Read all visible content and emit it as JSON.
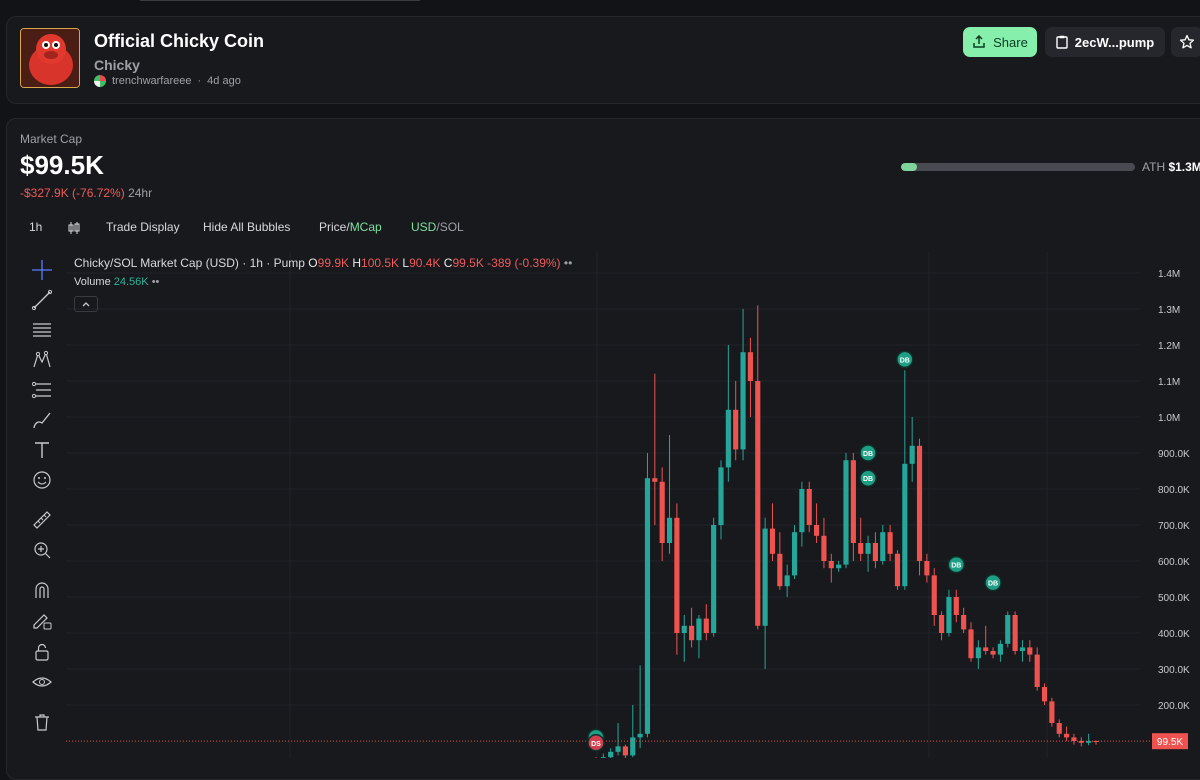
{
  "token": {
    "name": "Official Chicky Coin",
    "ticker": "Chicky",
    "creator": "trenchwarfareee",
    "age": "4d ago"
  },
  "actions": {
    "share_label": "Share",
    "contract_label": "2ecW...pump"
  },
  "market_cap": {
    "label": "Market Cap",
    "value": "$99.5K",
    "change": "-$327.9K (-76.72%)",
    "period": "24hr",
    "ath_label": "ATH",
    "ath_value": "$1.3M",
    "ath_progress": 0.07
  },
  "toolbar": {
    "interval": "1h",
    "trade_display": "Trade Display",
    "hide_bubbles": "Hide All Bubbles",
    "price_label": "Price",
    "mcap_label": "MCap",
    "usd_label": "USD",
    "sol_label": "SOL",
    "separator": "/"
  },
  "chart_legend": {
    "title": "Chicky/SOL Market Cap (USD) · 1h · Pump",
    "o_label": "O",
    "o_value": "99.9K",
    "h_label": "H",
    "h_value": "100.5K",
    "l_label": "L",
    "l_value": "90.4K",
    "c_label": "C",
    "c_value": "99.5K",
    "change": "-389 (-0.39%)",
    "volume_label": "Volume",
    "volume_value": "24.56K"
  },
  "side_tools": [
    "crosshair-icon",
    "trend-line-icon",
    "horizontal-lines-icon",
    "pattern-icon",
    "measure-lines-icon",
    "brush-icon",
    "text-icon",
    "emoji-icon",
    "ruler-icon",
    "zoom-icon",
    "magnet-icon",
    "lock-pencil-icon",
    "lock-icon",
    "eye-icon",
    "trash-icon"
  ],
  "colors": {
    "up": "#26a69a",
    "down": "#ef5350",
    "accent": "#86efac",
    "background": "#18191d"
  },
  "chart_data": {
    "type": "candlestick",
    "y_ticks": [
      "1.4M",
      "1.3M",
      "1.2M",
      "1.1M",
      "1.0M",
      "900.0K",
      "800.0K",
      "700.0K",
      "600.0K",
      "500.0K",
      "400.0K",
      "300.0K",
      "200.0K"
    ],
    "ylim": [
      80000,
      1430000
    ],
    "last_price_label": "99.5K",
    "last_price": 99500,
    "ohlc": [
      {
        "o": 42000,
        "h": 55000,
        "l": 28000,
        "c": 35000
      },
      {
        "o": 35000,
        "h": 65000,
        "l": 25000,
        "c": 55000
      },
      {
        "o": 55000,
        "h": 80000,
        "l": 40000,
        "c": 70000
      },
      {
        "o": 70000,
        "h": 150000,
        "l": 60000,
        "c": 85000
      },
      {
        "o": 85000,
        "h": 90000,
        "l": 40000,
        "c": 60000
      },
      {
        "o": 60000,
        "h": 200000,
        "l": 55000,
        "c": 110000
      },
      {
        "o": 110000,
        "h": 310000,
        "l": 80000,
        "c": 120000
      },
      {
        "o": 120000,
        "h": 900000,
        "l": 110000,
        "c": 830000
      },
      {
        "o": 830000,
        "h": 1120000,
        "l": 700000,
        "c": 820000
      },
      {
        "o": 820000,
        "h": 860000,
        "l": 600000,
        "c": 650000
      },
      {
        "o": 650000,
        "h": 950000,
        "l": 620000,
        "c": 720000
      },
      {
        "o": 720000,
        "h": 760000,
        "l": 340000,
        "c": 400000
      },
      {
        "o": 400000,
        "h": 450000,
        "l": 320000,
        "c": 420000
      },
      {
        "o": 420000,
        "h": 470000,
        "l": 360000,
        "c": 380000
      },
      {
        "o": 380000,
        "h": 450000,
        "l": 330000,
        "c": 440000
      },
      {
        "o": 440000,
        "h": 480000,
        "l": 380000,
        "c": 400000
      },
      {
        "o": 400000,
        "h": 720000,
        "l": 390000,
        "c": 700000
      },
      {
        "o": 700000,
        "h": 880000,
        "l": 660000,
        "c": 860000
      },
      {
        "o": 860000,
        "h": 1200000,
        "l": 820000,
        "c": 1020000
      },
      {
        "o": 1020000,
        "h": 1100000,
        "l": 880000,
        "c": 910000
      },
      {
        "o": 910000,
        "h": 1300000,
        "l": 880000,
        "c": 1180000
      },
      {
        "o": 1180000,
        "h": 1220000,
        "l": 1000000,
        "c": 1100000
      },
      {
        "o": 1100000,
        "h": 1310000,
        "l": 410000,
        "c": 420000
      },
      {
        "o": 420000,
        "h": 720000,
        "l": 300000,
        "c": 690000
      },
      {
        "o": 690000,
        "h": 760000,
        "l": 600000,
        "c": 620000
      },
      {
        "o": 620000,
        "h": 680000,
        "l": 520000,
        "c": 530000
      },
      {
        "o": 530000,
        "h": 590000,
        "l": 500000,
        "c": 560000
      },
      {
        "o": 560000,
        "h": 700000,
        "l": 550000,
        "c": 680000
      },
      {
        "o": 680000,
        "h": 820000,
        "l": 640000,
        "c": 800000
      },
      {
        "o": 800000,
        "h": 820000,
        "l": 680000,
        "c": 700000
      },
      {
        "o": 700000,
        "h": 760000,
        "l": 650000,
        "c": 670000
      },
      {
        "o": 670000,
        "h": 720000,
        "l": 580000,
        "c": 600000
      },
      {
        "o": 600000,
        "h": 620000,
        "l": 540000,
        "c": 580000
      },
      {
        "o": 580000,
        "h": 600000,
        "l": 570000,
        "c": 590000
      },
      {
        "o": 590000,
        "h": 900000,
        "l": 580000,
        "c": 880000
      },
      {
        "o": 880000,
        "h": 900000,
        "l": 600000,
        "c": 650000
      },
      {
        "o": 650000,
        "h": 720000,
        "l": 600000,
        "c": 620000
      },
      {
        "o": 620000,
        "h": 670000,
        "l": 570000,
        "c": 650000
      },
      {
        "o": 650000,
        "h": 680000,
        "l": 580000,
        "c": 600000
      },
      {
        "o": 600000,
        "h": 700000,
        "l": 590000,
        "c": 680000
      },
      {
        "o": 680000,
        "h": 700000,
        "l": 600000,
        "c": 620000
      },
      {
        "o": 620000,
        "h": 630000,
        "l": 520000,
        "c": 530000
      },
      {
        "o": 530000,
        "h": 1130000,
        "l": 520000,
        "c": 870000
      },
      {
        "o": 870000,
        "h": 1000000,
        "l": 820000,
        "c": 920000
      },
      {
        "o": 920000,
        "h": 940000,
        "l": 560000,
        "c": 600000
      },
      {
        "o": 600000,
        "h": 620000,
        "l": 540000,
        "c": 560000
      },
      {
        "o": 560000,
        "h": 580000,
        "l": 420000,
        "c": 450000
      },
      {
        "o": 450000,
        "h": 460000,
        "l": 380000,
        "c": 400000
      },
      {
        "o": 400000,
        "h": 520000,
        "l": 390000,
        "c": 500000
      },
      {
        "o": 500000,
        "h": 520000,
        "l": 430000,
        "c": 450000
      },
      {
        "o": 450000,
        "h": 470000,
        "l": 400000,
        "c": 410000
      },
      {
        "o": 410000,
        "h": 430000,
        "l": 320000,
        "c": 330000
      },
      {
        "o": 330000,
        "h": 380000,
        "l": 300000,
        "c": 360000
      },
      {
        "o": 360000,
        "h": 420000,
        "l": 340000,
        "c": 350000
      },
      {
        "o": 350000,
        "h": 360000,
        "l": 330000,
        "c": 340000
      },
      {
        "o": 340000,
        "h": 380000,
        "l": 320000,
        "c": 370000
      },
      {
        "o": 370000,
        "h": 460000,
        "l": 360000,
        "c": 450000
      },
      {
        "o": 450000,
        "h": 460000,
        "l": 340000,
        "c": 350000
      },
      {
        "o": 350000,
        "h": 380000,
        "l": 320000,
        "c": 360000
      },
      {
        "o": 360000,
        "h": 380000,
        "l": 320000,
        "c": 340000
      },
      {
        "o": 340000,
        "h": 360000,
        "l": 240000,
        "c": 250000
      },
      {
        "o": 250000,
        "h": 260000,
        "l": 200000,
        "c": 210000
      },
      {
        "o": 210000,
        "h": 220000,
        "l": 140000,
        "c": 150000
      },
      {
        "o": 150000,
        "h": 160000,
        "l": 110000,
        "c": 120000
      },
      {
        "o": 120000,
        "h": 140000,
        "l": 100000,
        "c": 110000
      },
      {
        "o": 110000,
        "h": 120000,
        "l": 90000,
        "c": 100000
      },
      {
        "o": 100000,
        "h": 110000,
        "l": 85000,
        "c": 95000
      },
      {
        "o": 95000,
        "h": 120000,
        "l": 88000,
        "c": 100000
      },
      {
        "o": 100000,
        "h": 101000,
        "l": 90000,
        "c": 99500
      }
    ],
    "bubbles": [
      {
        "label": "DB",
        "index": 0,
        "value": 110000,
        "kind": "buy"
      },
      {
        "label": "DS",
        "index": 0,
        "value": 95000,
        "kind": "sell"
      },
      {
        "label": "DB",
        "index": 42,
        "value": 1160000,
        "kind": "buy"
      },
      {
        "label": "DB",
        "index": 37,
        "value": 900000,
        "kind": "buy"
      },
      {
        "label": "DB",
        "index": 37,
        "value": 830000,
        "kind": "buy"
      },
      {
        "label": "DB",
        "index": 49,
        "value": 590000,
        "kind": "buy"
      },
      {
        "label": "DB",
        "index": 54,
        "value": 540000,
        "kind": "buy"
      }
    ]
  }
}
